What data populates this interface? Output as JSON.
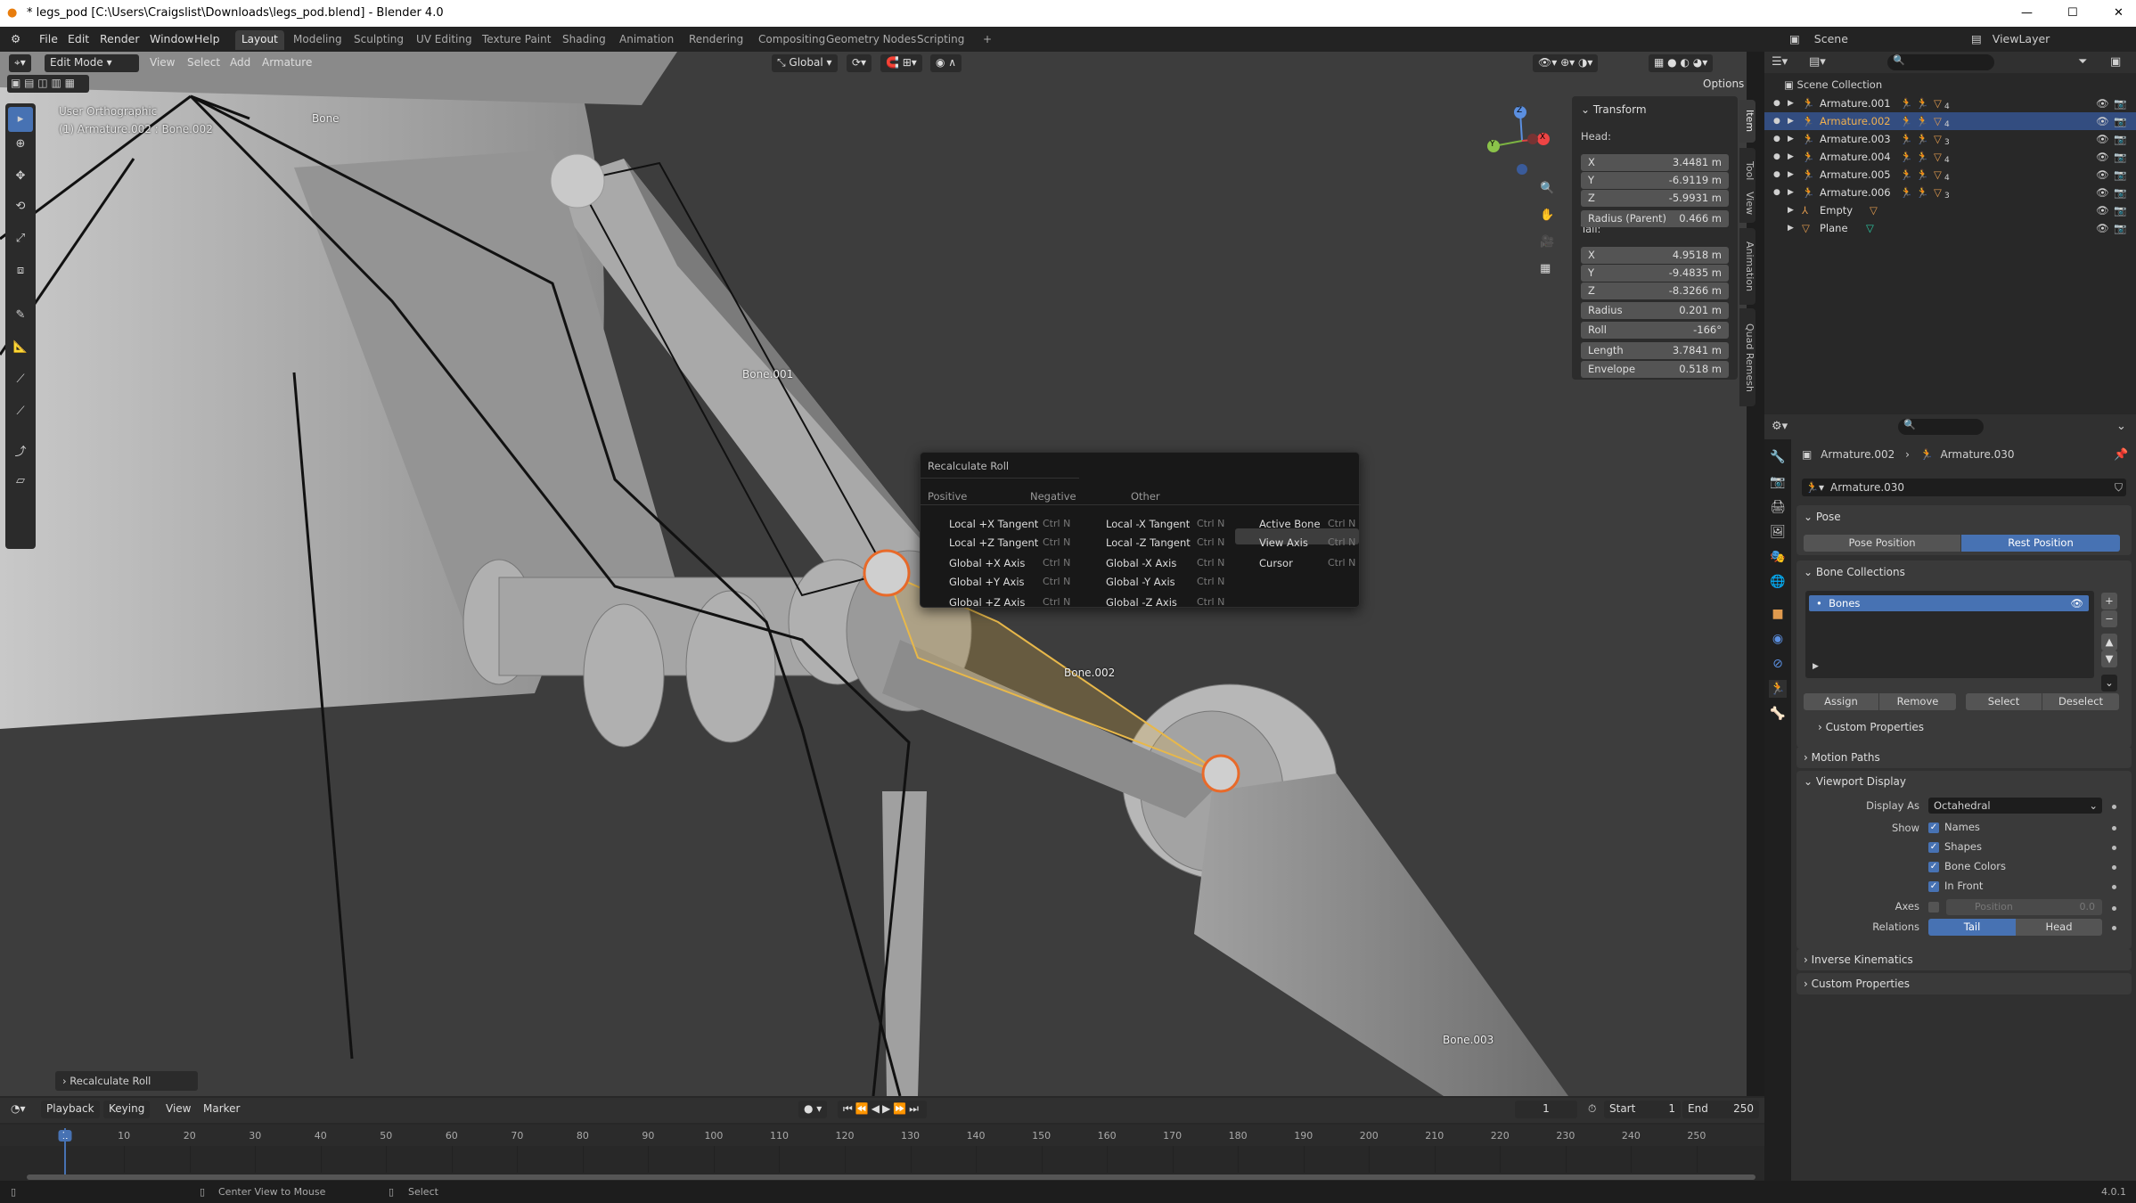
{
  "window": {
    "title": "* legs_pod [C:\\Users\\Craigslist\\Downloads\\legs_pod.blend] - Blender 4.0",
    "controls": [
      "—",
      "☐",
      "✕"
    ]
  },
  "menu": [
    "File",
    "Edit",
    "Render",
    "Window",
    "Help"
  ],
  "workspaces": [
    {
      "label": "Layout",
      "active": true
    },
    {
      "label": "Modeling"
    },
    {
      "label": "Sculpting"
    },
    {
      "label": "UV Editing"
    },
    {
      "label": "Texture Paint"
    },
    {
      "label": "Shading"
    },
    {
      "label": "Animation"
    },
    {
      "label": "Rendering"
    },
    {
      "label": "Compositing"
    },
    {
      "label": "Geometry Nodes"
    },
    {
      "label": "Scripting"
    },
    {
      "label": "+"
    }
  ],
  "scene": {
    "name": "Scene",
    "view_layer": "ViewLayer"
  },
  "viewport": {
    "mode": "Edit Mode",
    "menus": [
      "View",
      "Select",
      "Add",
      "Armature"
    ],
    "orientation": "Global",
    "options": "Options",
    "view_name": "User Orthographic",
    "context": "(1) Armature.002 : Bone.002",
    "bone_labels": [
      "Bone",
      "Bone.001",
      "Bone.002",
      "Bone.003"
    ],
    "last_op": "Recalculate Roll",
    "gizmo": {
      "x": "X",
      "y": "Y",
      "z": "Z"
    },
    "selected_bone_color": "#e8b84a"
  },
  "npanel": {
    "title": "Transform",
    "head_label": "Head:",
    "tail_label": "Tail:",
    "rows": [
      {
        "label": "X",
        "value": "3.4481 m"
      },
      {
        "label": "Y",
        "value": "-6.9119 m"
      },
      {
        "label": "Z",
        "value": "-5.9931 m"
      },
      {
        "label": "Radius (Parent)",
        "value": "0.466 m"
      },
      {
        "label": "X",
        "value": "4.9518 m"
      },
      {
        "label": "Y",
        "value": "-9.4835 m"
      },
      {
        "label": "Z",
        "value": "-8.3266 m"
      },
      {
        "label": "Radius",
        "value": "0.201 m"
      },
      {
        "label": "Roll",
        "value": "-166°"
      },
      {
        "label": "Length",
        "value": "3.7841 m"
      },
      {
        "label": "Envelope",
        "value": "0.518 m"
      }
    ],
    "tabs": [
      "Item",
      "Tool",
      "View",
      "Animation",
      "Quad Remesh"
    ]
  },
  "popup": {
    "title": "Recalculate Roll",
    "columns": [
      {
        "header": "Positive",
        "items": [
          "Local +X Tangent",
          "Local +Z Tangent",
          "Global +X Axis",
          "Global +Y Axis",
          "Global +Z Axis"
        ]
      },
      {
        "header": "Negative",
        "items": [
          "Local -X Tangent",
          "Local -Z Tangent",
          "Global -X Axis",
          "Global -Y Axis",
          "Global -Z Axis"
        ]
      },
      {
        "header": "Other",
        "items": [
          "Active Bone",
          "View Axis",
          "Cursor"
        ]
      }
    ],
    "shortcut": "Ctrl N",
    "highlighted": "View Axis"
  },
  "outliner": {
    "root": "Scene Collection",
    "items": [
      {
        "name": "Armature.001",
        "type": "armature",
        "count": "4"
      },
      {
        "name": "Armature.002",
        "type": "armature",
        "count": "4",
        "selected": true
      },
      {
        "name": "Armature.003",
        "type": "armature",
        "count": "3"
      },
      {
        "name": "Armature.004",
        "type": "armature",
        "count": "4"
      },
      {
        "name": "Armature.005",
        "type": "armature",
        "count": "4"
      },
      {
        "name": "Armature.006",
        "type": "armature",
        "count": "3"
      },
      {
        "name": "Empty",
        "type": "empty"
      },
      {
        "name": "Plane",
        "type": "mesh"
      }
    ]
  },
  "properties": {
    "breadcrumb": [
      "Armature.002",
      "Armature.030"
    ],
    "data_name": "Armature.030",
    "pose": {
      "title": "Pose",
      "buttons": [
        "Pose Position",
        "Rest Position"
      ],
      "active": "Rest Position"
    },
    "bone_collections": {
      "title": "Bone Collections",
      "items": [
        "Bones"
      ],
      "buttons": [
        "Assign",
        "Remove",
        "Select",
        "Deselect"
      ],
      "custom_props": "Custom Properties"
    },
    "motion_paths": "Motion Paths",
    "viewport_display": {
      "title": "Viewport Display",
      "display_as_label": "Display As",
      "display_as": "Octahedral",
      "show_label": "Show",
      "show": [
        {
          "label": "Names",
          "checked": true
        },
        {
          "label": "Shapes",
          "checked": true
        },
        {
          "label": "Bone Colors",
          "checked": true
        },
        {
          "label": "In Front",
          "checked": true
        }
      ],
      "axes_label": "Axes",
      "axes_position_label": "Position",
      "axes_position": "0.0",
      "relations_label": "Relations",
      "relations": [
        "Tail",
        "Head"
      ],
      "relations_active": "Tail"
    },
    "inverse_kinematics": "Inverse Kinematics",
    "custom_properties": "Custom Properties"
  },
  "timeline": {
    "menus": [
      "Playback",
      "Keying",
      "View",
      "Marker"
    ],
    "current_frame": "1",
    "start_label": "Start",
    "start": "1",
    "end_label": "End",
    "end": "250",
    "ticks": [
      "1",
      "10",
      "20",
      "30",
      "40",
      "50",
      "60",
      "70",
      "80",
      "90",
      "100",
      "110",
      "120",
      "130",
      "140",
      "150",
      "160",
      "170",
      "180",
      "190",
      "200",
      "210",
      "220",
      "230",
      "240",
      "250"
    ]
  },
  "status": {
    "hints": [
      "Center View to Mouse",
      "Select"
    ],
    "version": "4.0.1"
  },
  "colors": {
    "accent": "#4772b3",
    "selection": "#334d80",
    "armature_icon": "#e09a4e",
    "data_icon": "#2cc9a3"
  }
}
